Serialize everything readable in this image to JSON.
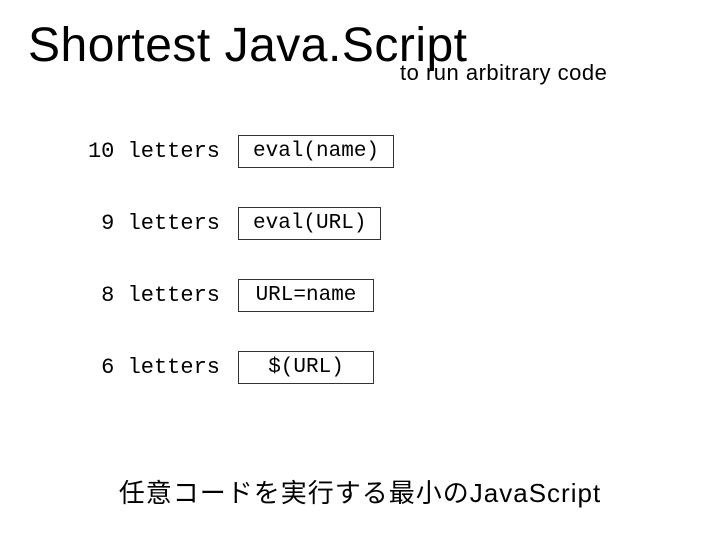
{
  "title": "Shortest Java.Script",
  "subtitle": "to run arbitrary code",
  "rows": [
    {
      "label": "10 letters",
      "code": "eval(name)"
    },
    {
      "label": "9 letters",
      "code": "eval(URL)"
    },
    {
      "label": "8 letters",
      "code": "URL=name"
    },
    {
      "label": "6 letters",
      "code": "$(URL)"
    }
  ],
  "footer": "任意コードを実行する最小のJavaScript"
}
